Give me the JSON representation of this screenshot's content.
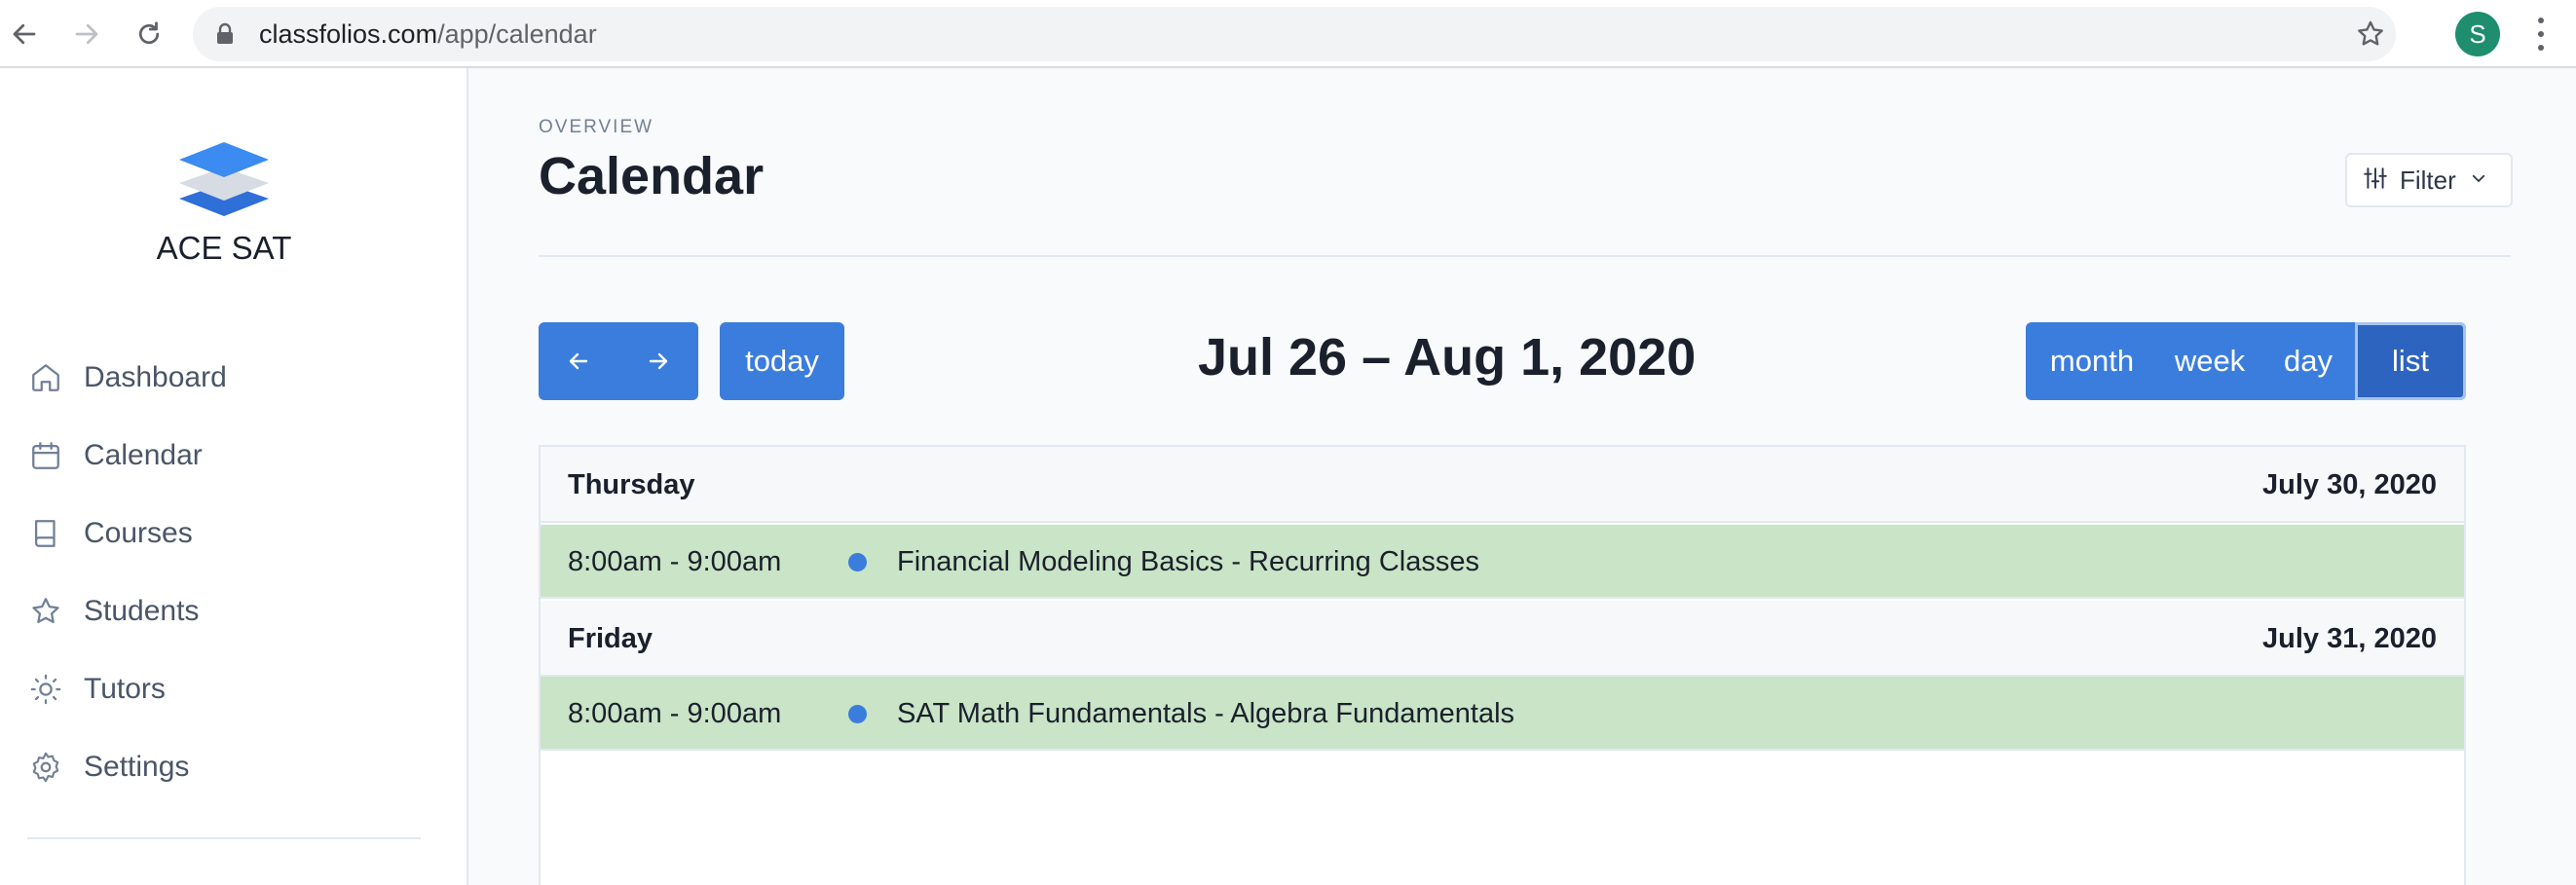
{
  "browser": {
    "url_domain": "classfolios.com",
    "url_path": "/app/calendar",
    "profile_initial": "S",
    "icons": [
      "back-arrow-icon",
      "forward-arrow-icon",
      "reload-icon",
      "lock-icon",
      "star-icon",
      "kebab-menu-icon"
    ]
  },
  "sidebar": {
    "brand": "ACE SAT",
    "items": [
      {
        "label": "Dashboard",
        "icon": "home-icon"
      },
      {
        "label": "Calendar",
        "icon": "calendar-icon"
      },
      {
        "label": "Courses",
        "icon": "book-icon"
      },
      {
        "label": "Students",
        "icon": "star-icon"
      },
      {
        "label": "Tutors",
        "icon": "sun-icon"
      },
      {
        "label": "Settings",
        "icon": "gear-icon"
      }
    ]
  },
  "header": {
    "overline": "OVERVIEW",
    "title": "Calendar",
    "filter_label": "Filter"
  },
  "toolbar": {
    "today_label": "today",
    "range_title": "Jul 26 – Aug 1, 2020",
    "views": [
      "month",
      "week",
      "day",
      "list"
    ],
    "active_view": "list"
  },
  "list": [
    {
      "day": "Thursday",
      "date": "July 30, 2020",
      "events": [
        {
          "time": "8:00am - 9:00am",
          "title": "Financial Modeling Basics - Recurring Classes"
        }
      ]
    },
    {
      "day": "Friday",
      "date": "July 31, 2020",
      "events": [
        {
          "time": "8:00am - 9:00am",
          "title": "SAT Math Fundamentals - Algebra Fundamentals"
        }
      ]
    }
  ],
  "colors": {
    "primary": "#3b7ddd",
    "primary_active": "#2c64bf",
    "event_bg": "#c9e4c6",
    "logo": "#2f7be5"
  }
}
